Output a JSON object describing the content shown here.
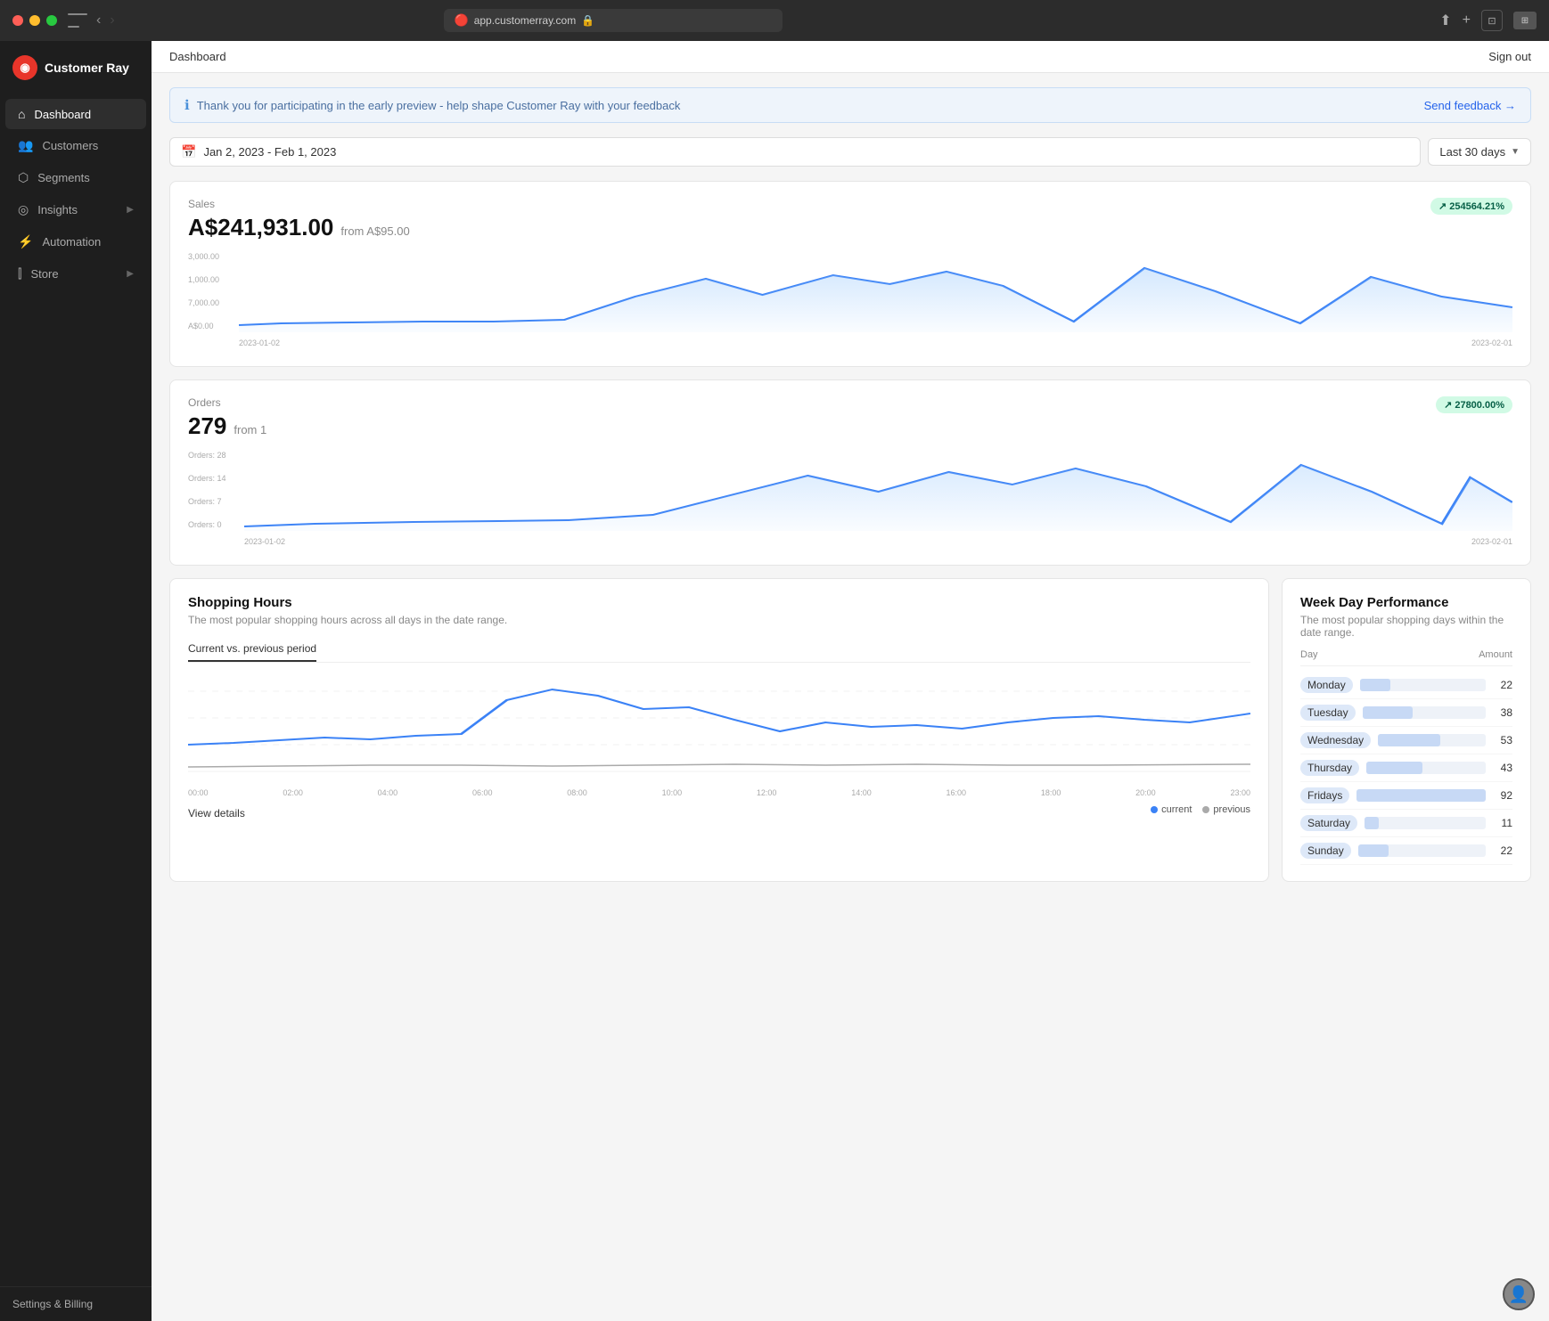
{
  "app": {
    "name": "Customer Ray",
    "url": "app.customerray.com",
    "tab_label": "Dashboard"
  },
  "nav": {
    "logo": "CR",
    "items": [
      {
        "id": "dashboard",
        "label": "Dashboard",
        "icon": "home",
        "active": true,
        "hasChevron": false
      },
      {
        "id": "customers",
        "label": "Customers",
        "icon": "users",
        "active": false,
        "hasChevron": false
      },
      {
        "id": "segments",
        "label": "Segments",
        "icon": "segments",
        "active": false,
        "hasChevron": false
      },
      {
        "id": "insights",
        "label": "Insights",
        "icon": "insights",
        "active": false,
        "hasChevron": true
      },
      {
        "id": "automation",
        "label": "Automation",
        "icon": "automation",
        "active": false,
        "hasChevron": false
      },
      {
        "id": "store",
        "label": "Store",
        "icon": "store",
        "active": false,
        "hasChevron": true
      }
    ],
    "footer": "Settings & Billing"
  },
  "header": {
    "title": "Dashboard",
    "signout": "Sign out"
  },
  "banner": {
    "text": "Thank you for participating in the early preview - help shape Customer Ray with your feedback",
    "link": "Send feedback →"
  },
  "datepicker": {
    "value": "Jan 2, 2023 - Feb 1, 2023",
    "period": "Last 30 days"
  },
  "sales": {
    "label": "Sales",
    "value": "A$241,931.00",
    "from": "from A$95.00",
    "badge": "254564.21%",
    "y_labels": [
      "3,000.00",
      "1,000.00",
      "7,000.00",
      "A$0.00"
    ],
    "x_start": "2023-01-02",
    "x_end": "2023-02-01"
  },
  "orders": {
    "label": "Orders",
    "value": "279",
    "from": "from 1",
    "badge": "27800.00%",
    "y_labels": [
      "Orders: 28",
      "Orders: 14",
      "Orders: 7",
      "Orders: 0"
    ],
    "x_start": "2023-01-02",
    "x_end": "2023-02-01"
  },
  "shopping_hours": {
    "title": "Shopping Hours",
    "subtitle": "The most popular shopping hours across all days in the date range.",
    "tab": "Current vs. previous period",
    "x_labels": [
      "00:00",
      "02:00",
      "04:00",
      "06:00",
      "08:00",
      "10:00",
      "12:00",
      "14:00",
      "16:00",
      "18:00",
      "20:00",
      "23:00"
    ],
    "legend_current": "current",
    "legend_previous": "previous",
    "view_details": "View details"
  },
  "weekday": {
    "title": "Week Day Performance",
    "subtitle": "The most popular shopping days within the date range.",
    "col_day": "Day",
    "col_amount": "Amount",
    "rows": [
      {
        "day": "Monday",
        "amount": 22,
        "max": 92
      },
      {
        "day": "Tuesday",
        "amount": 38,
        "max": 92
      },
      {
        "day": "Wednesday",
        "amount": 53,
        "max": 92
      },
      {
        "day": "Thursday",
        "amount": 43,
        "max": 92
      },
      {
        "day": "Fridays",
        "amount": 92,
        "max": 92
      },
      {
        "day": "Saturday",
        "amount": 11,
        "max": 92
      },
      {
        "day": "Sunday",
        "amount": 22,
        "max": 92
      }
    ]
  }
}
